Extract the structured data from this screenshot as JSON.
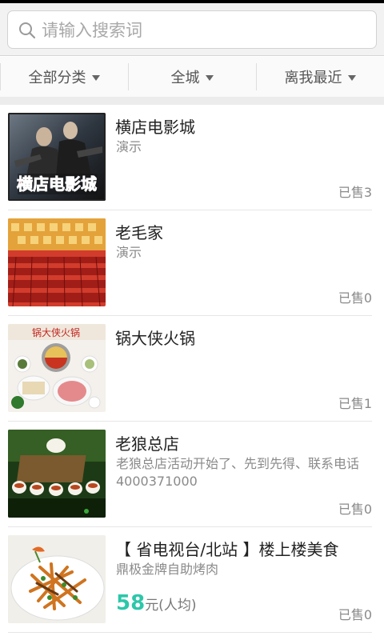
{
  "search": {
    "placeholder": "请输入搜索词",
    "icon": "search-icon"
  },
  "filters": [
    {
      "label": "全部分类"
    },
    {
      "label": "全城"
    },
    {
      "label": "离我最近"
    }
  ],
  "items": [
    {
      "title": "横店电影城",
      "subtitle": "演示",
      "sold": "已售3",
      "thumb_text": "横店电影城"
    },
    {
      "title": "老毛家",
      "subtitle": "演示",
      "sold": "已售0"
    },
    {
      "title": "锅大侠火锅",
      "subtitle": "",
      "sold": "已售1",
      "thumb_text": "锅大侠火锅"
    },
    {
      "title": "老狼总店",
      "subtitle": "老狼总店活动开始了、先到先得、联系电话4000371000",
      "sold": "已售0"
    },
    {
      "title": "【 省电视台/北站 】楼上楼美食",
      "subtitle": "鼎极金牌自助烤肉",
      "sold": "已售0",
      "price": "58",
      "price_unit": "元(人均)"
    }
  ],
  "colors": {
    "accent": "#2cc7a9",
    "border": "#d2d2d2"
  }
}
